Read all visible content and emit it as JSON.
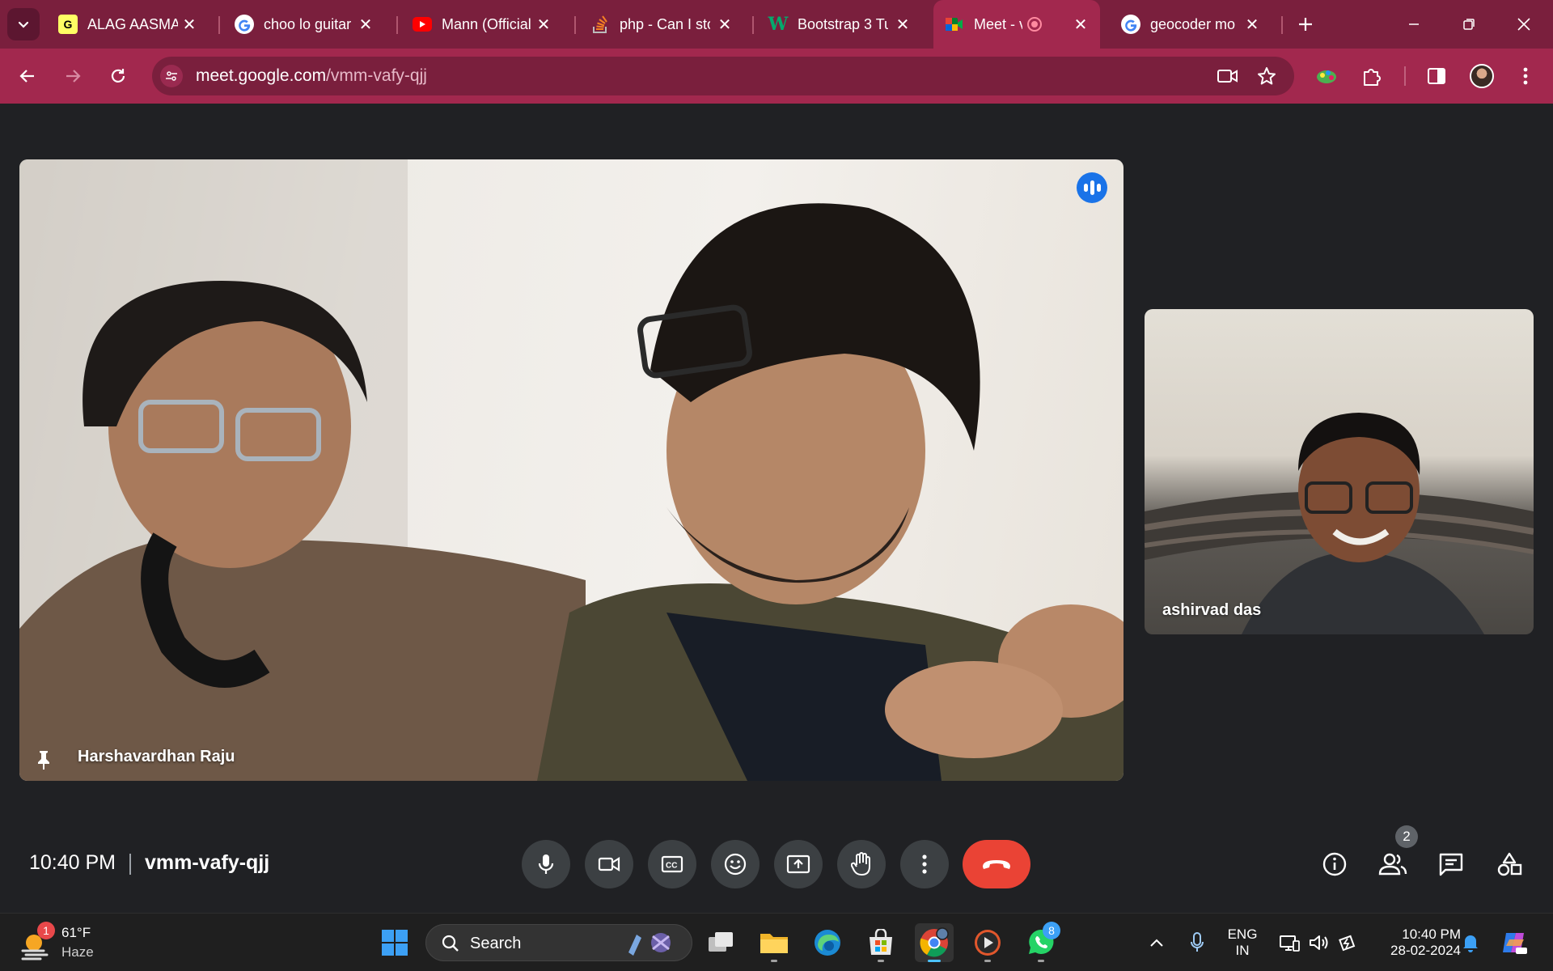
{
  "browser": {
    "tabs": [
      {
        "title": "ALAG AASMAN",
        "favicon": "genius-icon"
      },
      {
        "title": "choo lo guitar",
        "favicon": "google-icon"
      },
      {
        "title": "Mann (Official",
        "favicon": "youtube-icon"
      },
      {
        "title": "php - Can I sto",
        "favicon": "stackoverflow-icon"
      },
      {
        "title": "Bootstrap 3 Tu",
        "favicon": "w3schools-icon"
      },
      {
        "title": "Meet - vm",
        "favicon": "meet-icon",
        "active": true,
        "recording": true
      },
      {
        "title": "geocoder mo",
        "favicon": "google-icon"
      }
    ],
    "url_host": "meet.google.com",
    "url_path": "/vmm-vafy-qjj"
  },
  "meet": {
    "participants": [
      {
        "name": "Harshavardhan Raju",
        "pinned": true,
        "speaking": true
      },
      {
        "name": "ashirvad das"
      }
    ],
    "time": "10:40 PM",
    "meeting_code": "vmm-vafy-qjj",
    "participant_count": "2",
    "controls": [
      "microphone-icon",
      "camera-icon",
      "captions-icon",
      "emoji-icon",
      "present-icon",
      "raise-hand-icon",
      "more-icon",
      "end-call-icon"
    ],
    "right_controls": [
      "info-icon",
      "people-icon",
      "chat-icon",
      "activities-icon"
    ]
  },
  "taskbar": {
    "weather_temp": "61°F",
    "weather_desc": "Haze",
    "weather_badge": "1",
    "search_label": "Search",
    "whatsapp_badge": "8",
    "lang_top": "ENG",
    "lang_bottom": "IN",
    "clock_time": "10:40 PM",
    "clock_date": "28-02-2024"
  },
  "colors": {
    "chrome_dark": "#7a1f3d",
    "chrome_light": "#a2284e",
    "meet_bg": "#202124",
    "end_call": "#ea4335",
    "speaking_blue": "#1a73e8"
  }
}
